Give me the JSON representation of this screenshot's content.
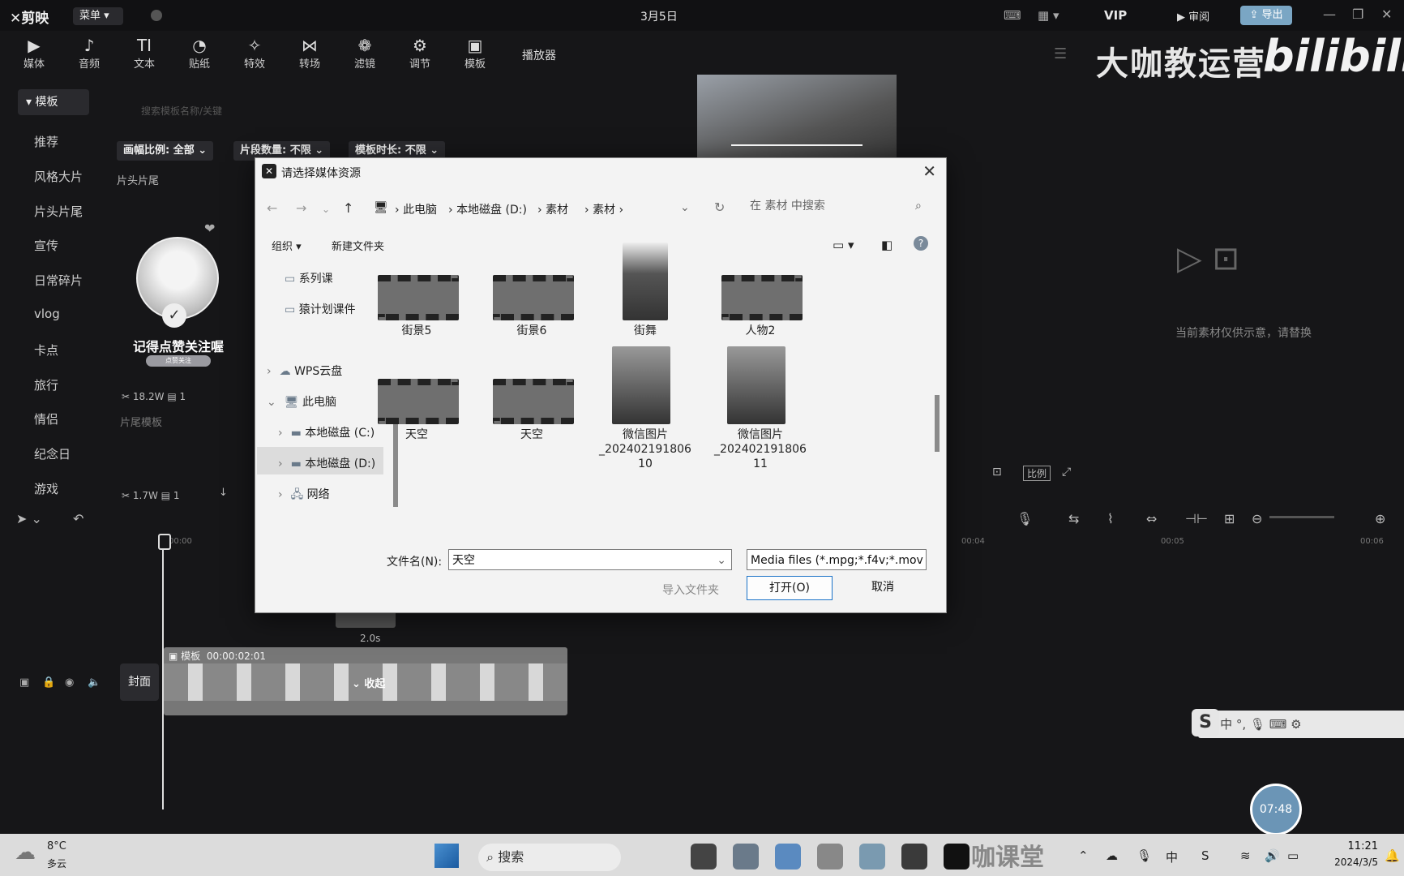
{
  "app": {
    "logo": "剪映",
    "menu": "菜单",
    "date_title": "3月5日",
    "vip": "VIP",
    "review": "审阅",
    "export": "导出"
  },
  "toolbar": {
    "tools": [
      {
        "icon": "▶",
        "label": "媒体"
      },
      {
        "icon": "♪",
        "label": "音频"
      },
      {
        "icon": "TI",
        "label": "文本"
      },
      {
        "icon": "◔",
        "label": "贴纸"
      },
      {
        "icon": "✧",
        "label": "特效"
      },
      {
        "icon": "⋈",
        "label": "转场"
      },
      {
        "icon": "❁",
        "label": "滤镜"
      },
      {
        "icon": "⚙",
        "label": "调节"
      },
      {
        "icon": "▣",
        "label": "模板"
      }
    ],
    "player": "播放器"
  },
  "watermark": {
    "text": "大咖教运营",
    "bili": "bilibili"
  },
  "sidebar": {
    "header": "模板",
    "items": [
      "推荐",
      "风格大片",
      "片头片尾",
      "宣传",
      "日常碎片",
      "vlog",
      "卡点",
      "旅行",
      "情侣",
      "纪念日",
      "游戏"
    ]
  },
  "template_panel": {
    "search_placeholder": "搜索模板名称/关键",
    "filters": [
      "画幅比例: 全部",
      "片段数量: 不限",
      "模板时长: 不限"
    ],
    "section": "片头片尾",
    "card": {
      "title": "记得点赞关注喔",
      "tag": "点赞关注",
      "uses": "18.2W",
      "clips": "1",
      "subtitle": "片尾模板",
      "uses2": "1.7W",
      "clips2": "1"
    }
  },
  "dialog": {
    "title": "请选择媒体资源",
    "breadcrumb": [
      "此电脑",
      "本地磁盘 (D:)",
      "素材",
      "素材"
    ],
    "search_placeholder": "在 素材 中搜索",
    "organize": "组织",
    "new_folder": "新建文件夹",
    "nav": [
      {
        "label": "系列课",
        "indent": 1
      },
      {
        "label": "猿计划课件",
        "indent": 1
      },
      {
        "label": "WPS云盘",
        "indent": 0
      },
      {
        "label": "此电脑",
        "indent": 0
      },
      {
        "label": "本地磁盘 (C:)",
        "indent": 1
      },
      {
        "label": "本地磁盘 (D:)",
        "indent": 1
      },
      {
        "label": "网络",
        "indent": 0
      }
    ],
    "files": [
      {
        "name": "街景5",
        "kind": "video"
      },
      {
        "name": "街景6",
        "kind": "video"
      },
      {
        "name": "街舞",
        "kind": "portrait"
      },
      {
        "name": "人物2",
        "kind": "video"
      },
      {
        "name": "天空",
        "kind": "video"
      },
      {
        "name": "天空",
        "kind": "video"
      },
      {
        "name": "微信图片\n_202402191806\n10",
        "kind": "image"
      },
      {
        "name": "微信图片\n_202402191806\n11",
        "kind": "image"
      }
    ],
    "filename_label": "文件名(N):",
    "filename_value": "天空",
    "filetype": "Media files (*.mpg;*.f4v;*.mov",
    "import_folder": "导入文件夹",
    "open": "打开(O)",
    "cancel": "取消"
  },
  "right_panel": {
    "placeholder_text": "当前素材仅供示意，请替换",
    "ratio": "比例"
  },
  "timeline": {
    "ruler": [
      "00:00",
      "00:04",
      "00:05",
      "00:06"
    ],
    "clip_duration": "2.0s",
    "track_label": "模板",
    "track_time": "00:00:02:01",
    "collapse": "收起",
    "cover": "封面"
  },
  "overlay": {
    "ime_s": "S",
    "ime_lang": "中",
    "timer": "07:48"
  },
  "taskbar": {
    "temp": "8°C",
    "weather": "多云",
    "search": "搜索",
    "kct": "咖课堂",
    "lang": "中",
    "time": "11:21",
    "date": "2024/3/5"
  }
}
